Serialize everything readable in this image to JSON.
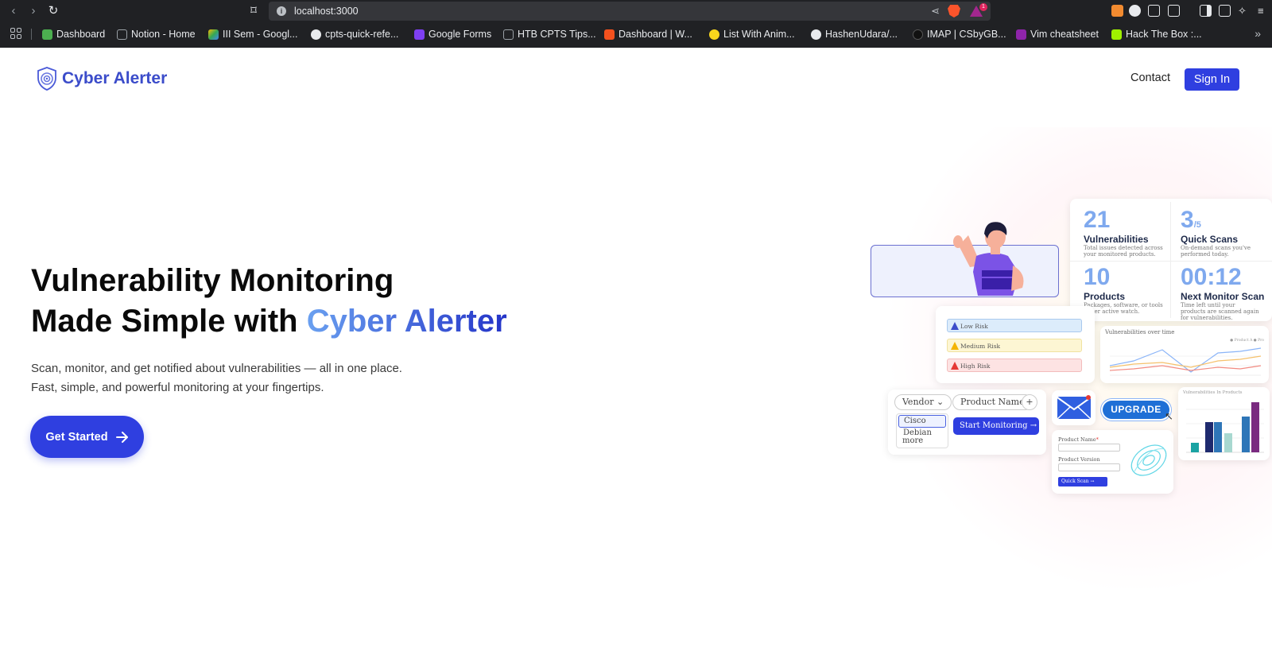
{
  "browser": {
    "url": "localhost:3000",
    "rewards_badge": "1",
    "bookmarks": [
      {
        "label": "Dashboard",
        "color": "#4caf50"
      },
      {
        "label": "Notion - Home",
        "color": "#9aa0a6"
      },
      {
        "label": "III Sem - Googl...",
        "color": "#fbbc04"
      },
      {
        "label": "cpts-quick-refe...",
        "color": "#e8eaed"
      },
      {
        "label": "Google Forms",
        "color": "#7e3ff2"
      },
      {
        "label": "HTB CPTS Tips...",
        "color": "#9aa0a6"
      },
      {
        "label": "Dashboard | W...",
        "color": "#f4511e"
      },
      {
        "label": "List With Anim...",
        "color": "#f9d71c"
      },
      {
        "label": "HashenUdara/...",
        "color": "#e8eaed"
      },
      {
        "label": "IMAP | CSbyGB...",
        "color": "#111111"
      },
      {
        "label": "Vim cheatsheet",
        "color": "#8e24aa"
      },
      {
        "label": "Hack The Box :...",
        "color": "#9fef00"
      }
    ],
    "more": "»"
  },
  "site": {
    "brand": "Cyber Alerter",
    "nav": {
      "contact": "Contact",
      "sign_in": "Sign In"
    }
  },
  "hero": {
    "title_line1": "Vulnerability Monitoring",
    "title_line2_prefix": "Made Simple with ",
    "title_accent": "Cyber Alerter",
    "subtitle_line1": "Scan, monitor, and get notified about vulnerabilities — all in one place.",
    "subtitle_line2": "Fast, simple, and powerful monitoring at your fingertips.",
    "cta": "Get Started"
  },
  "illustration": {
    "stats": [
      {
        "value": "21",
        "suffix": "",
        "title": "Vulnerabilities",
        "desc": "Total issues detected across your monitored products."
      },
      {
        "value": "3",
        "suffix": "/5",
        "title": "Quick Scans",
        "desc": "On-demand scans you've performed today."
      },
      {
        "value": "10",
        "suffix": "",
        "title": "Products",
        "desc": "Packages, software, or tools under active watch."
      },
      {
        "value": "00:12",
        "suffix": "",
        "title": "Next Monitor Scan",
        "desc": "Time left until your products are scanned again for vulnerabilities."
      }
    ],
    "risks": [
      {
        "label": "Low Risk",
        "bg": "#dcecfb",
        "border": "#a9c9ee",
        "icon": "#3b4cca"
      },
      {
        "label": "Medium Risk",
        "bg": "#fdf6d3",
        "border": "#f0e2a0",
        "icon": "#f4b400"
      },
      {
        "label": "High Risk",
        "bg": "#fde3e3",
        "border": "#f3bcbc",
        "icon": "#e53935"
      }
    ],
    "monitor": {
      "vendor": "Vendor",
      "product_name": "Product Name",
      "options": [
        "Cisco",
        "Debian",
        "more"
      ],
      "start": "Start Monitoring →"
    },
    "quick_scan": {
      "product_name_label": "Product Name",
      "product_version_label": "Product Version",
      "button": "Quick Scan →"
    },
    "upgrade": "UPGRADE",
    "line_chart": {
      "title": "Vulnerabilities over time",
      "legend": "● Product A ● Pro"
    },
    "bar_chart": {
      "title": "Vulnerabilities In Products"
    }
  }
}
